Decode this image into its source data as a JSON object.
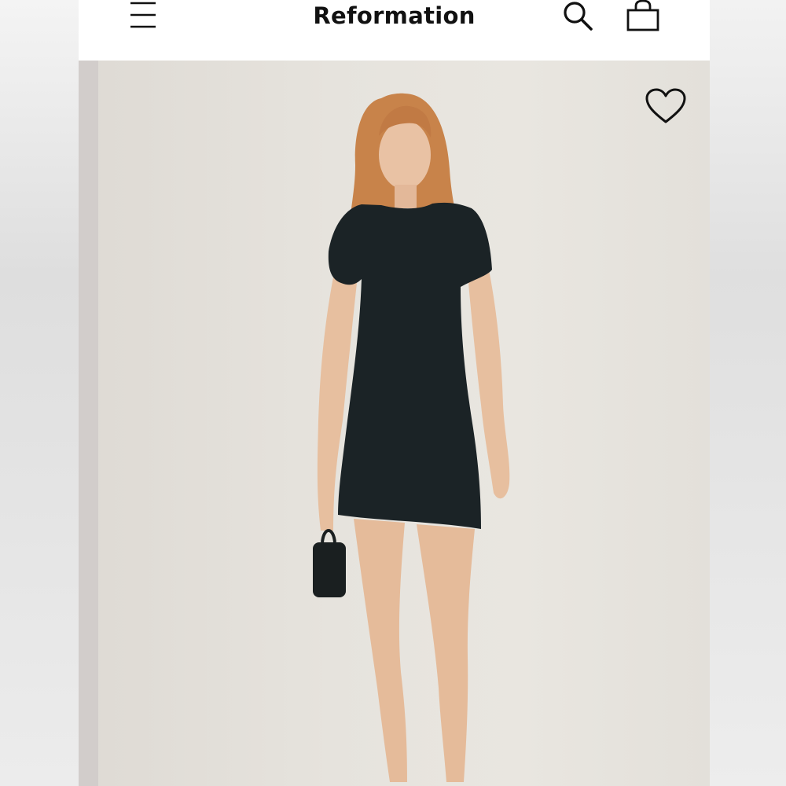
{
  "header": {
    "brand": "Reformation",
    "menu_icon": "hamburger-menu-icon",
    "search_icon": "search-icon",
    "bag_icon": "shopping-bag-icon"
  },
  "product": {
    "wishlist_icon": "heart-outline-icon",
    "image_description_icon": "product-photo"
  },
  "colors": {
    "header_bg": "#ffffff",
    "text": "#111111",
    "photo_bg": "#e6e3dd",
    "dress": "#1b2326"
  }
}
